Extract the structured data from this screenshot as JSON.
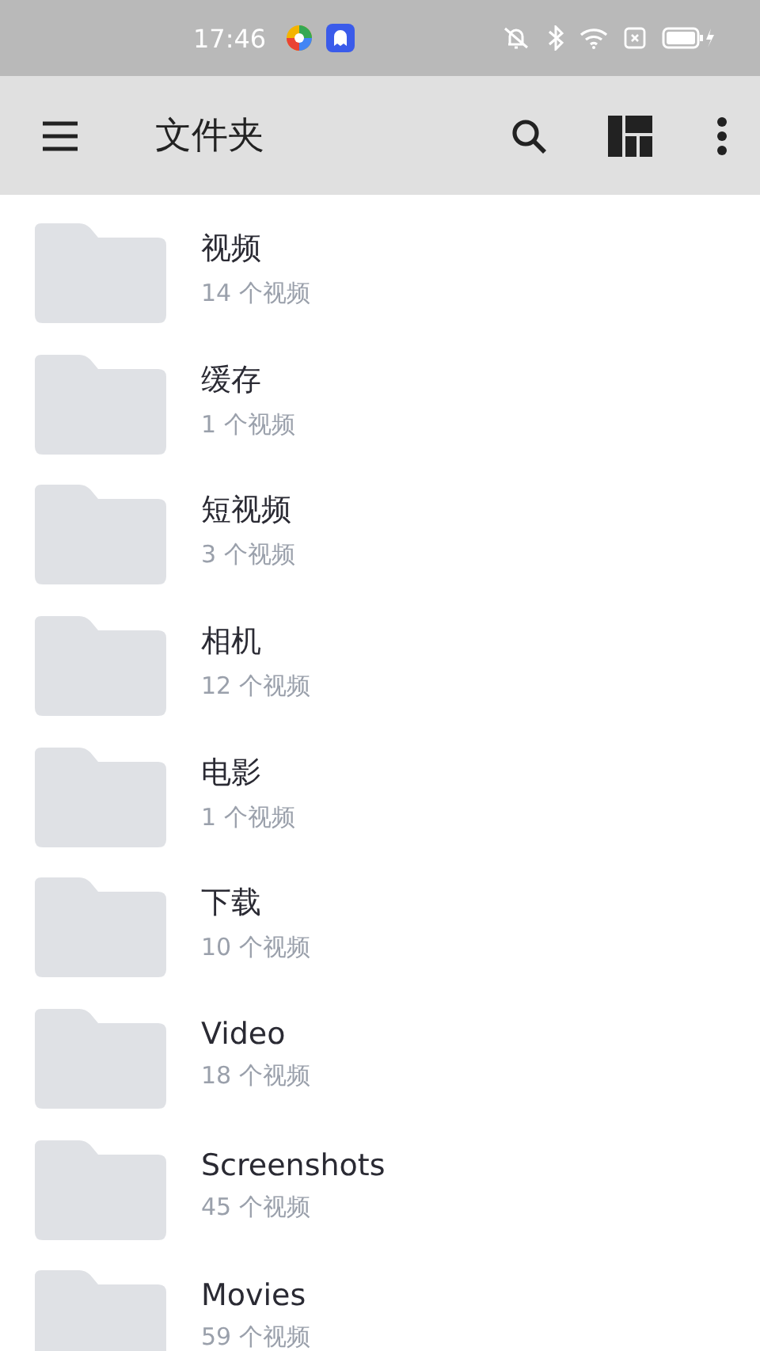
{
  "status_bar": {
    "time": "17:46"
  },
  "toolbar": {
    "title": "文件夹"
  },
  "folders": [
    {
      "name": "视频",
      "count": "14 个视频"
    },
    {
      "name": "缓存",
      "count": "1 个视频"
    },
    {
      "name": "短视频",
      "count": "3 个视频"
    },
    {
      "name": "相机",
      "count": "12 个视频"
    },
    {
      "name": "电影",
      "count": "1 个视频"
    },
    {
      "name": "下载",
      "count": "10 个视频"
    },
    {
      "name": "Video",
      "count": "18 个视频"
    },
    {
      "name": "Screenshots",
      "count": "45 个视频"
    },
    {
      "name": "Movies",
      "count": "59 个视频"
    }
  ]
}
